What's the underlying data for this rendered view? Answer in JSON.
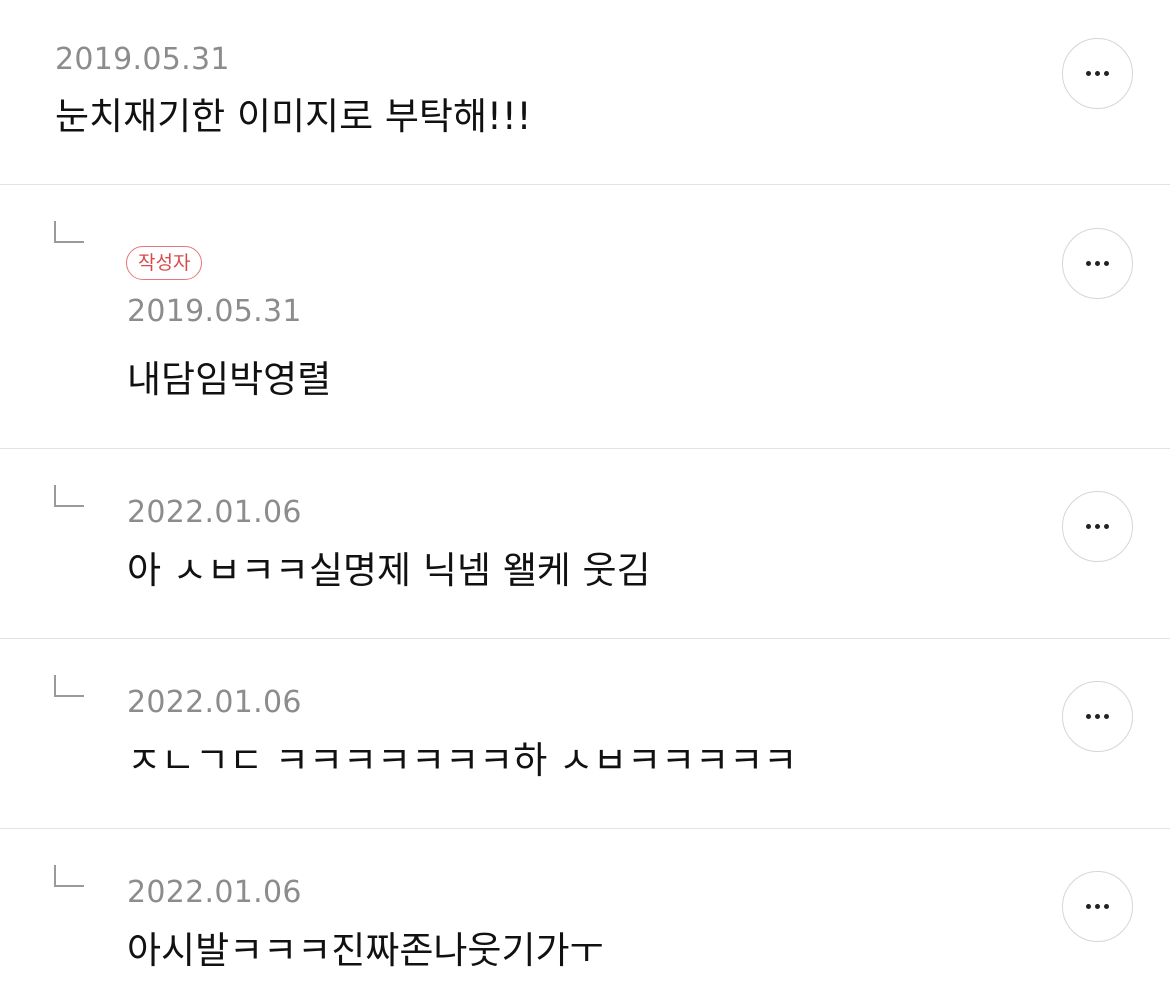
{
  "comments": [
    {
      "date": "2019.05.31",
      "text": "눈치재기한 이미지로 부탁해!!!"
    },
    {
      "badge": "작성자",
      "date": "2019.05.31",
      "text": "내담임박영렬"
    },
    {
      "date": "2022.01.06",
      "text": "아 ㅅㅂㅋㅋ실명제 닉넴 왤케 웃김"
    },
    {
      "date": "2022.01.06",
      "text": "ㅈㄴㄱㄷ ㅋㅋㅋㅋㅋㅋㅋ하 ㅅㅂㅋㅋㅋㅋㅋ"
    },
    {
      "date": "2022.01.06",
      "text": "아시발ㅋㅋㅋ진짜존나웃기가ㅜ"
    }
  ],
  "icons": {
    "more": "more-horizontal-icon",
    "reply": "reply-arrow-icon"
  },
  "colors": {
    "badge_border": "#e5797a",
    "badge_text": "#d9494b",
    "date_text": "#8c8c8c",
    "body_text": "#111111",
    "divider": "#e2e2e2"
  }
}
